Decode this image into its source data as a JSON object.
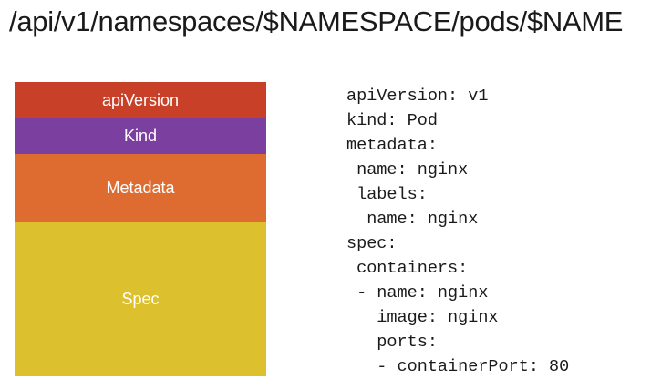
{
  "title": "/api/v1/namespaces/$NAMESPACE/pods/$NAME",
  "blocks": [
    {
      "label": "apiVersion",
      "color": "#c94028"
    },
    {
      "label": "Kind",
      "color": "#7b3fa0"
    },
    {
      "label": "Metadata",
      "color": "#de6c30"
    },
    {
      "label": "Spec",
      "color": "#dcc02e"
    }
  ],
  "yaml": {
    "lines": [
      "apiVersion: v1",
      "kind: Pod",
      "metadata:",
      " name: nginx",
      " labels:",
      "  name: nginx",
      "spec:",
      " containers:",
      " - name: nginx",
      "   image: nginx",
      "   ports:",
      "   - containerPort: 80"
    ]
  }
}
